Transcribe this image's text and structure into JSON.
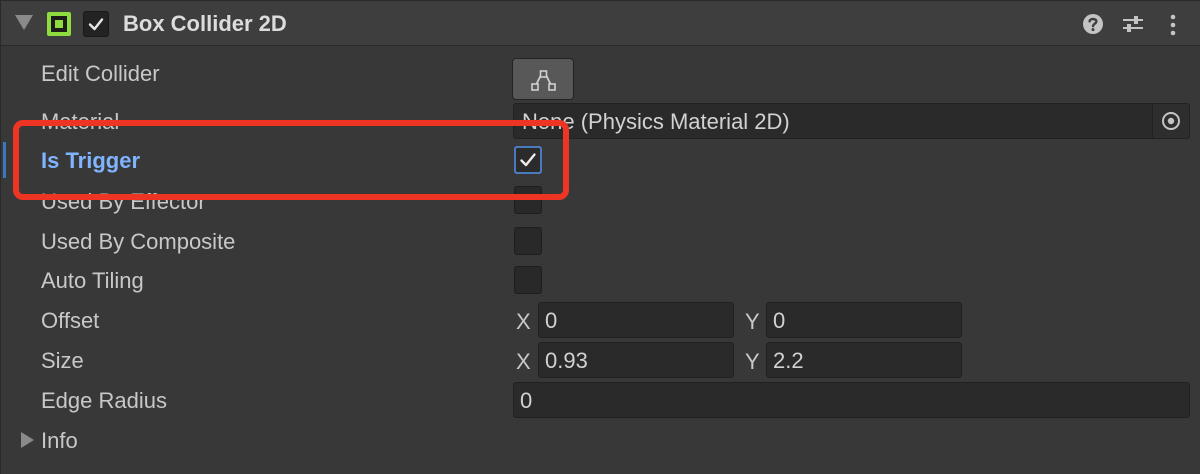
{
  "header": {
    "title": "Box Collider 2D",
    "enabled": true,
    "icons": [
      "help-icon",
      "presets-icon",
      "kebab-menu-icon"
    ],
    "accent_color": "#8fdc3f"
  },
  "rows": {
    "edit_collider": {
      "label": "Edit Collider",
      "button_icon": "edit-collider-icon"
    },
    "material": {
      "label": "Material",
      "value": "None (Physics Material 2D)",
      "picker_icon": "object-picker-icon"
    },
    "is_trigger": {
      "label": "Is Trigger",
      "checked": true
    },
    "used_by_effector": {
      "label": "Used By Effector",
      "checked": false
    },
    "used_by_composite": {
      "label": "Used By Composite",
      "checked": false
    },
    "auto_tiling": {
      "label": "Auto Tiling",
      "checked": false
    },
    "offset": {
      "label": "Offset",
      "x_label": "X",
      "x": "0",
      "y_label": "Y",
      "y": "0"
    },
    "size": {
      "label": "Size",
      "x_label": "X",
      "x": "0.93",
      "y_label": "Y",
      "y": "2.2"
    },
    "edge_radius": {
      "label": "Edge Radius",
      "value": "0"
    },
    "info": {
      "label": "Info"
    }
  },
  "annotation": {
    "highlight_color": "#ee3524"
  }
}
